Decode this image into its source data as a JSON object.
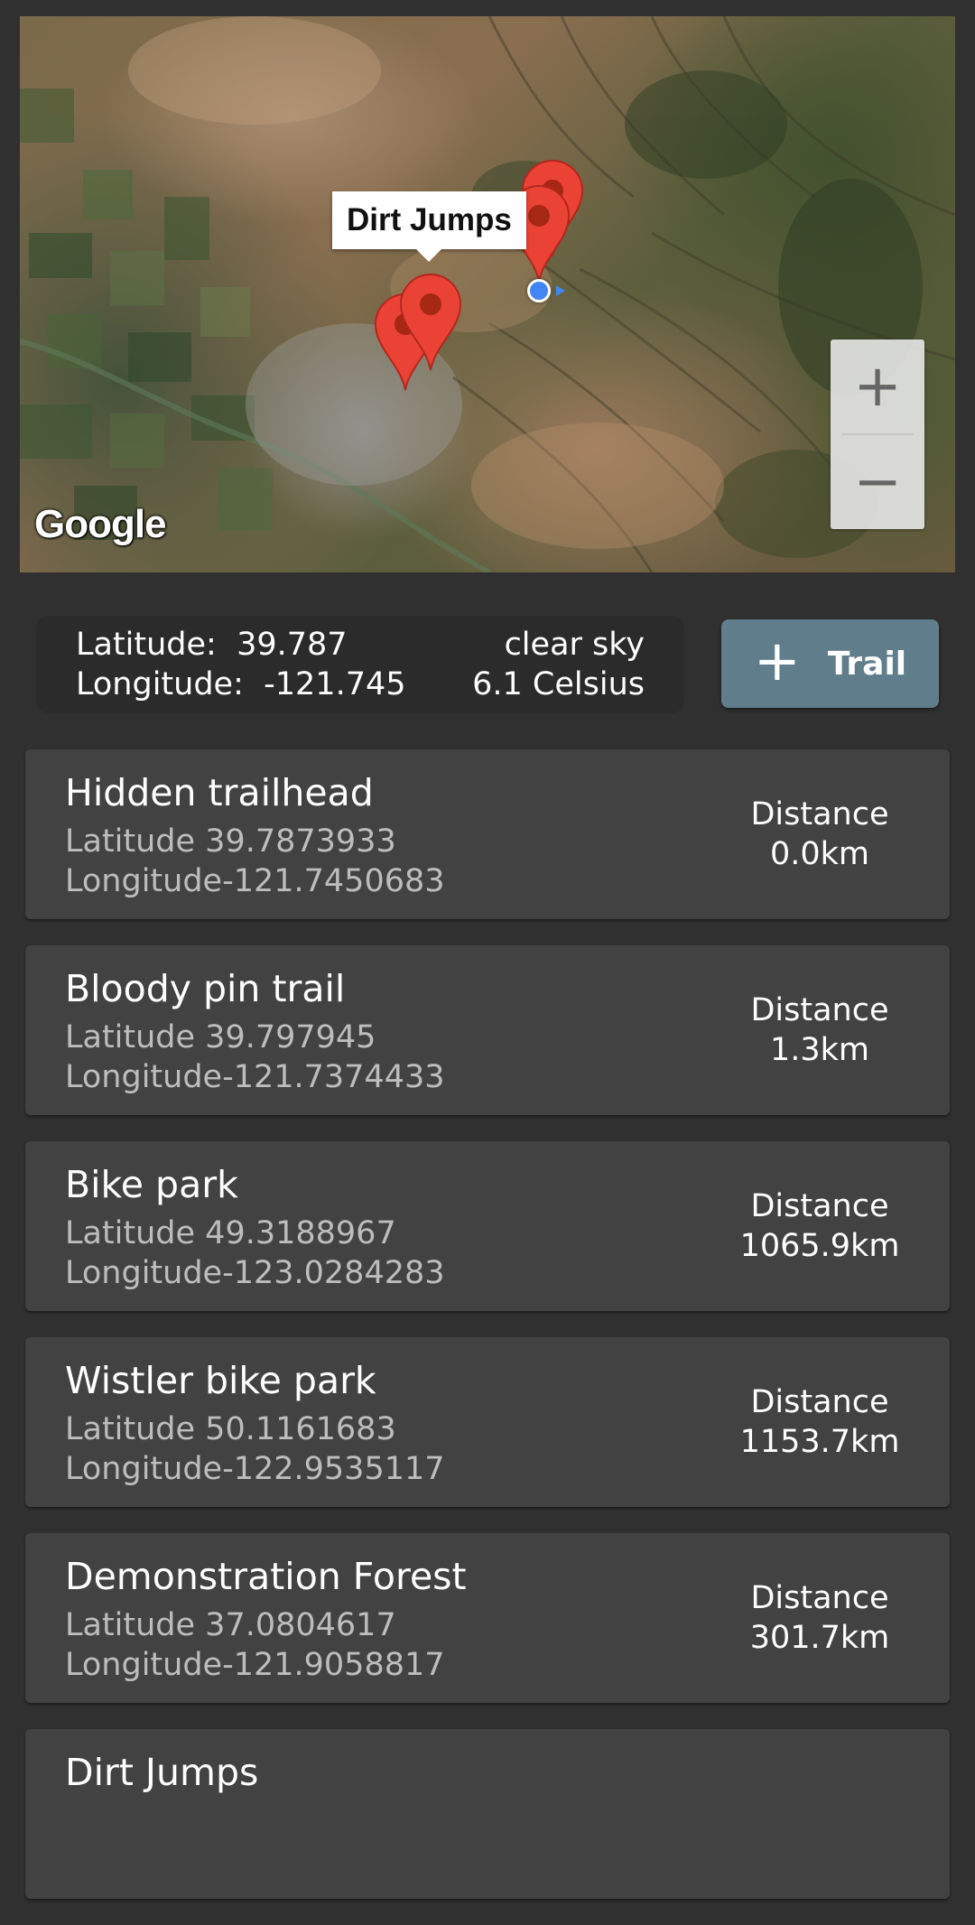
{
  "map": {
    "info_window_title": "Dirt Jumps",
    "attribution": "Google",
    "zoom_in_label": "+",
    "zoom_out_label": "−"
  },
  "location": {
    "latitude_label": "Latitude:",
    "latitude_value": "39.787",
    "longitude_label": "Longitude:",
    "longitude_value": "-121.745",
    "weather": "clear sky",
    "temperature": "6.1 Celsius"
  },
  "add_trail_button": {
    "icon": "plus-icon",
    "label": "Trail"
  },
  "trails": [
    {
      "name": "Hidden trailhead",
      "latitude": "Latitude 39.7873933",
      "longitude": "Longitude-121.7450683",
      "distance_label": "Distance",
      "distance": "0.0km"
    },
    {
      "name": "Bloody pin trail",
      "latitude": "Latitude 39.797945",
      "longitude": "Longitude-121.7374433",
      "distance_label": "Distance",
      "distance": "1.3km"
    },
    {
      "name": "Bike park",
      "latitude": "Latitude 49.3188967",
      "longitude": "Longitude-123.0284283",
      "distance_label": "Distance",
      "distance": "1065.9km"
    },
    {
      "name": "Wistler bike park",
      "latitude": "Latitude 50.1161683",
      "longitude": "Longitude-122.9535117",
      "distance_label": "Distance",
      "distance": "1153.7km"
    },
    {
      "name": "Demonstration Forest",
      "latitude": "Latitude 37.0804617",
      "longitude": "Longitude-121.9058817",
      "distance_label": "Distance",
      "distance": "301.7km"
    },
    {
      "name": "Dirt Jumps"
    }
  ],
  "colors": {
    "background": "#303030",
    "card": "#424242",
    "button": "#607d8b",
    "marker": "#ea4335",
    "my_location": "#4285f4"
  }
}
